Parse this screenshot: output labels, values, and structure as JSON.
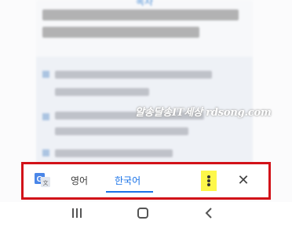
{
  "page": {
    "top_link": "목차"
  },
  "watermark": {
    "text": "알송달송IT세상 rdsong.com"
  },
  "translate_bar": {
    "highlight_color": "#d21219",
    "google_translate_icon": "google-translate-icon",
    "tabs": [
      {
        "label": "영어",
        "selected": false
      },
      {
        "label": "한국어",
        "selected": true
      }
    ],
    "accent_color": "#1a73e8",
    "more_icon": "vertical-dots-icon",
    "more_highlight_color": "#fdf74a",
    "close_icon": "close-icon",
    "close_glyph": "✕"
  },
  "nav_bar": {
    "buttons": [
      "recents-icon",
      "home-icon",
      "back-icon"
    ]
  }
}
